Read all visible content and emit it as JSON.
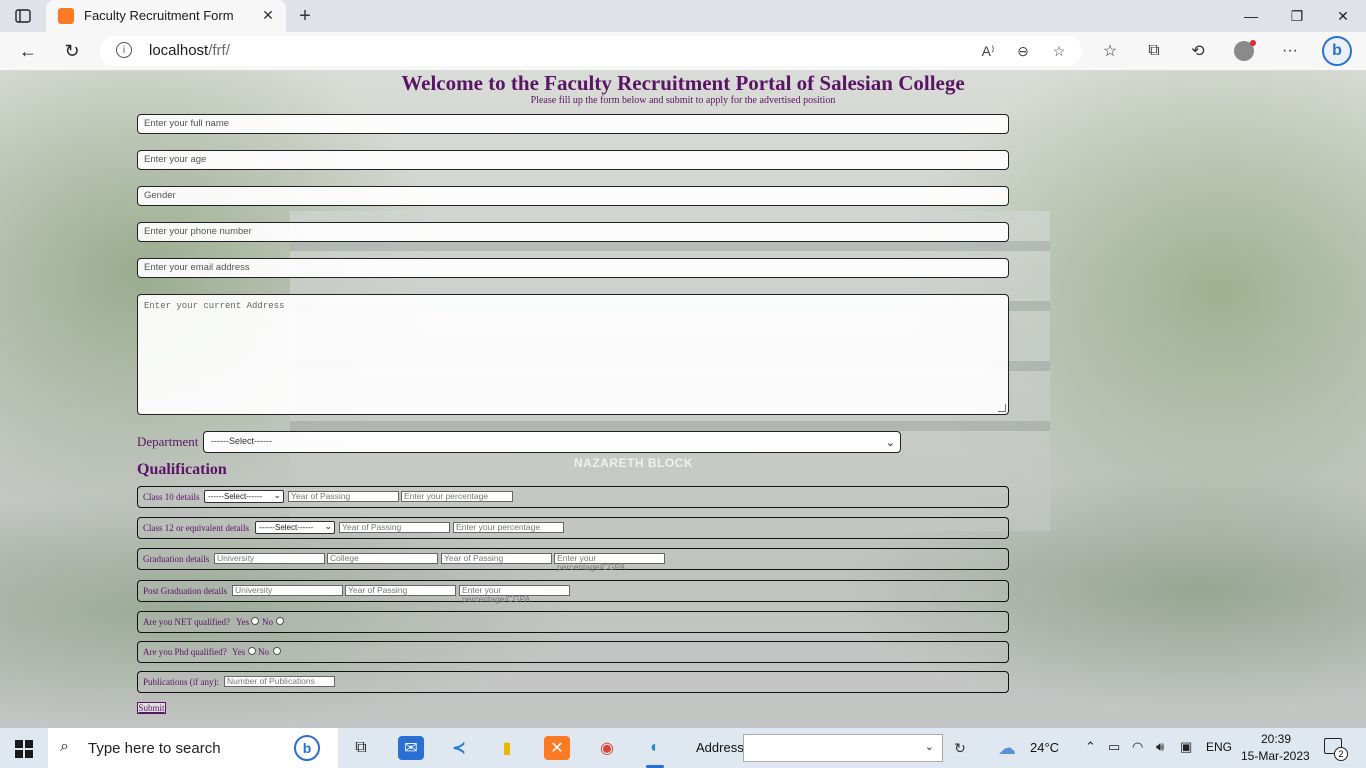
{
  "browser": {
    "tab_title": "Faculty Recruitment Form",
    "url_host": "localhost",
    "url_path": "/frf/"
  },
  "page": {
    "title": "Welcome to the Faculty Recruitment Portal of Salesian College",
    "subtitle": "Please fill up the form below and submit to apply for the advertised position",
    "background_sign": "NAZARETH BLOCK",
    "fields": {
      "full_name_placeholder": "Enter your full name",
      "age_placeholder": "Enter your age",
      "gender_placeholder": "Gender",
      "phone_placeholder": "Enter your phone number",
      "email_placeholder": "Enter your email address",
      "address_placeholder": "Enter your current Address"
    },
    "department": {
      "label": "Department",
      "selected": "------Select------"
    },
    "qualification": {
      "heading": "Qualification",
      "class10": {
        "label": "Class 10 details",
        "select": "------Select------",
        "year": "Year of Passing",
        "percentage": "Enter your percentage"
      },
      "class12": {
        "label": "Class 12 or equivalent details",
        "select": "------Select------",
        "year": "Year of Passing",
        "percentage": "Enter your percentage"
      },
      "graduation": {
        "label": "Graduation details",
        "university": "University",
        "college": "College",
        "year": "Year of Passing",
        "percentage": "Enter your percentage/CGPA"
      },
      "postgraduation": {
        "label": "Post Graduation details",
        "university": "University",
        "year": "Year of Passing",
        "percentage": "Enter your percentage/CGPA"
      },
      "net": {
        "label": "Are you NET qualified?",
        "yes": "Yes",
        "no": "No"
      },
      "phd": {
        "label": "Are you Phd qualified?",
        "yes": "Yes",
        "no": "No"
      },
      "publications": {
        "label": "Publications (if any):",
        "placeholder": "Number of Publications"
      }
    },
    "submit_label": "Submit"
  },
  "taskbar": {
    "search_placeholder": "Type here to search",
    "address_label": "Address",
    "temperature": "24°C",
    "language": "ENG",
    "time": "20:39",
    "date": "15-Mar-2023",
    "notification_count": "2"
  },
  "colors": {
    "form_accent": "#5a1466",
    "edge_accent": "#2a6fd6"
  }
}
